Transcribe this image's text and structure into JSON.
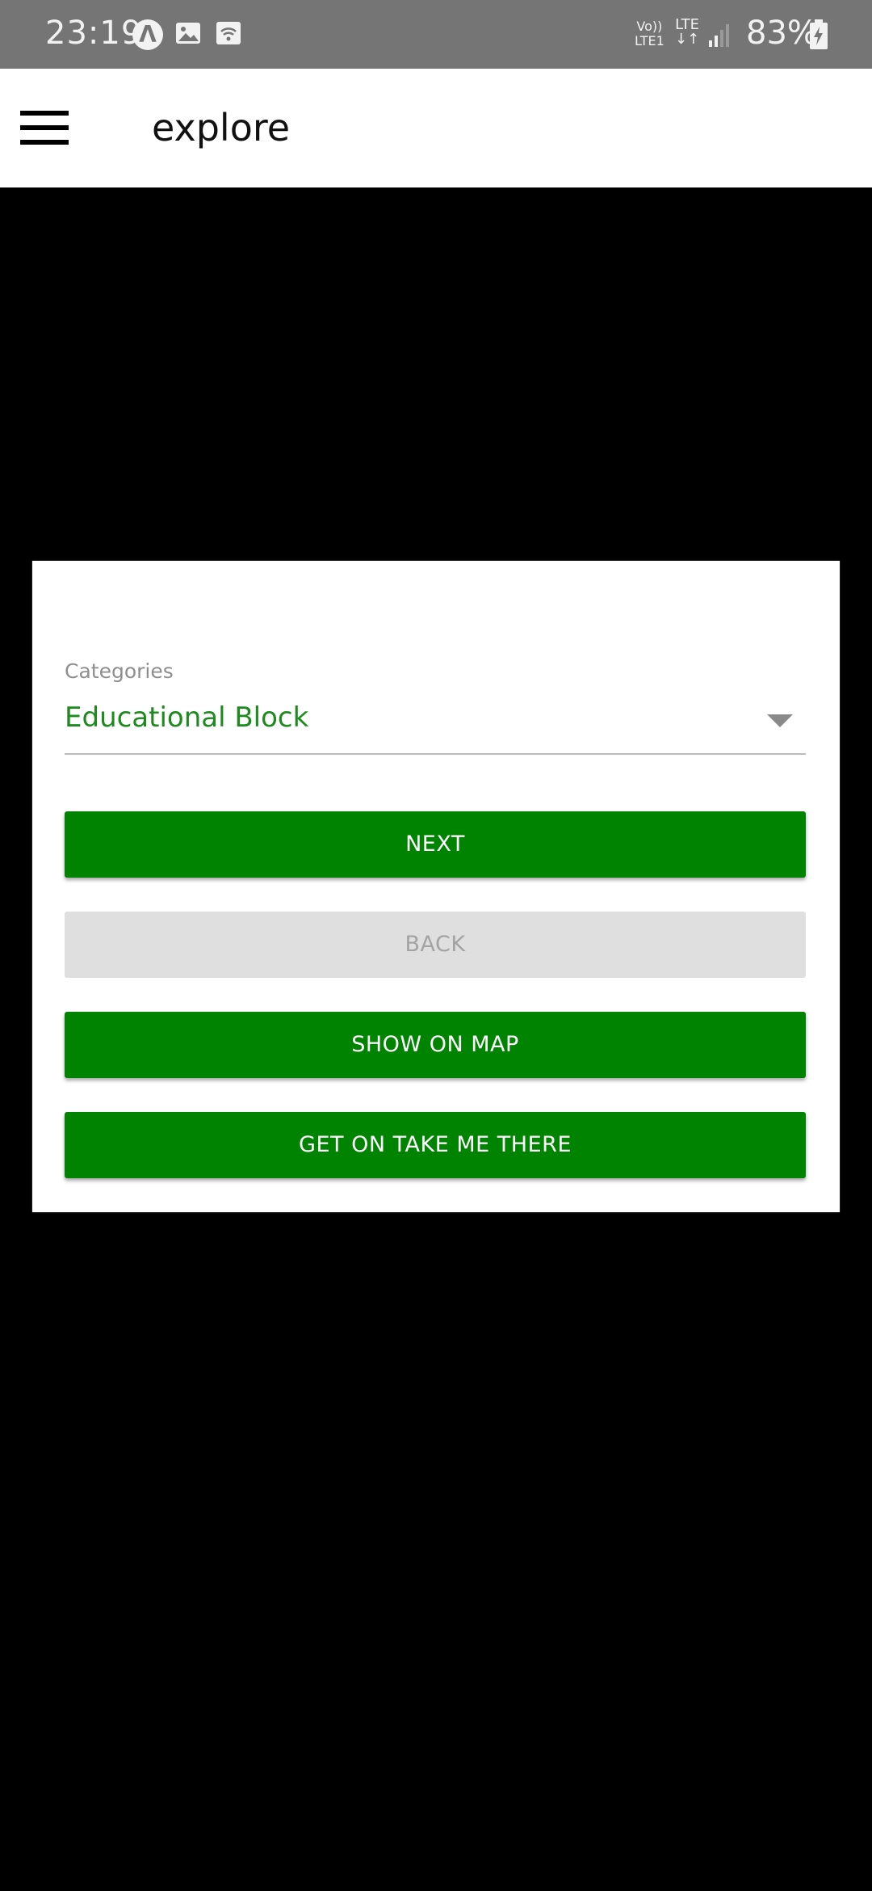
{
  "status_bar": {
    "time": "23:19",
    "volte_line1": "Vo))",
    "volte_line2": "LTE1",
    "lte_line1": "LTE",
    "lte_line2": "↓↑",
    "battery": "83%",
    "icons": [
      "a-circle-icon",
      "image-icon",
      "wifi-call-icon",
      "signal-icon",
      "battery-charging-icon"
    ]
  },
  "app_bar": {
    "title": "explore",
    "menu_icon": "hamburger-menu-icon"
  },
  "form": {
    "categories_label": "Categories",
    "categories_value": "Educational Block",
    "caret_icon": "dropdown-caret-icon"
  },
  "buttons": {
    "next": "NEXT",
    "back": "BACK",
    "show_on_map": "SHOW ON MAP",
    "take_me_there": "GET ON TAKE ME THERE"
  },
  "colors": {
    "primary_green": "#008300",
    "selected_text_green": "#1d8a1d",
    "status_bar": "#757575",
    "background": "#000000",
    "disabled_button": "#dfdfdf"
  }
}
